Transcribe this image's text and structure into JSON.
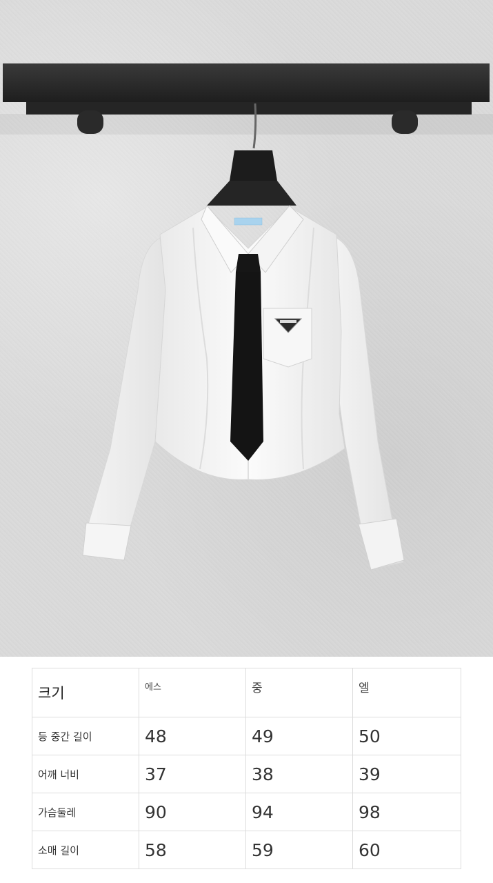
{
  "product_photo": {
    "description_icons": [
      "clothes-rack-icon",
      "hanger-icon",
      "shirt-icon",
      "tie-icon",
      "triangle-logo-icon"
    ],
    "colors": {
      "wall": "#d8d8d8",
      "rack": "#2a2a2a",
      "shirt": "#f6f6f6",
      "tie": "#151515",
      "label": "#a9d3ee"
    }
  },
  "size_table": {
    "header": {
      "label": "크기",
      "sizes": [
        "에스",
        "중",
        "엘"
      ]
    },
    "rows": [
      {
        "label": "등 중간 길이",
        "values": [
          "48",
          "49",
          "50"
        ]
      },
      {
        "label": "어깨 너비",
        "values": [
          "37",
          "38",
          "39"
        ]
      },
      {
        "label": "가슴둘레",
        "values": [
          "90",
          "94",
          "98"
        ]
      },
      {
        "label": "소매 길이",
        "values": [
          "58",
          "59",
          "60"
        ]
      }
    ]
  }
}
